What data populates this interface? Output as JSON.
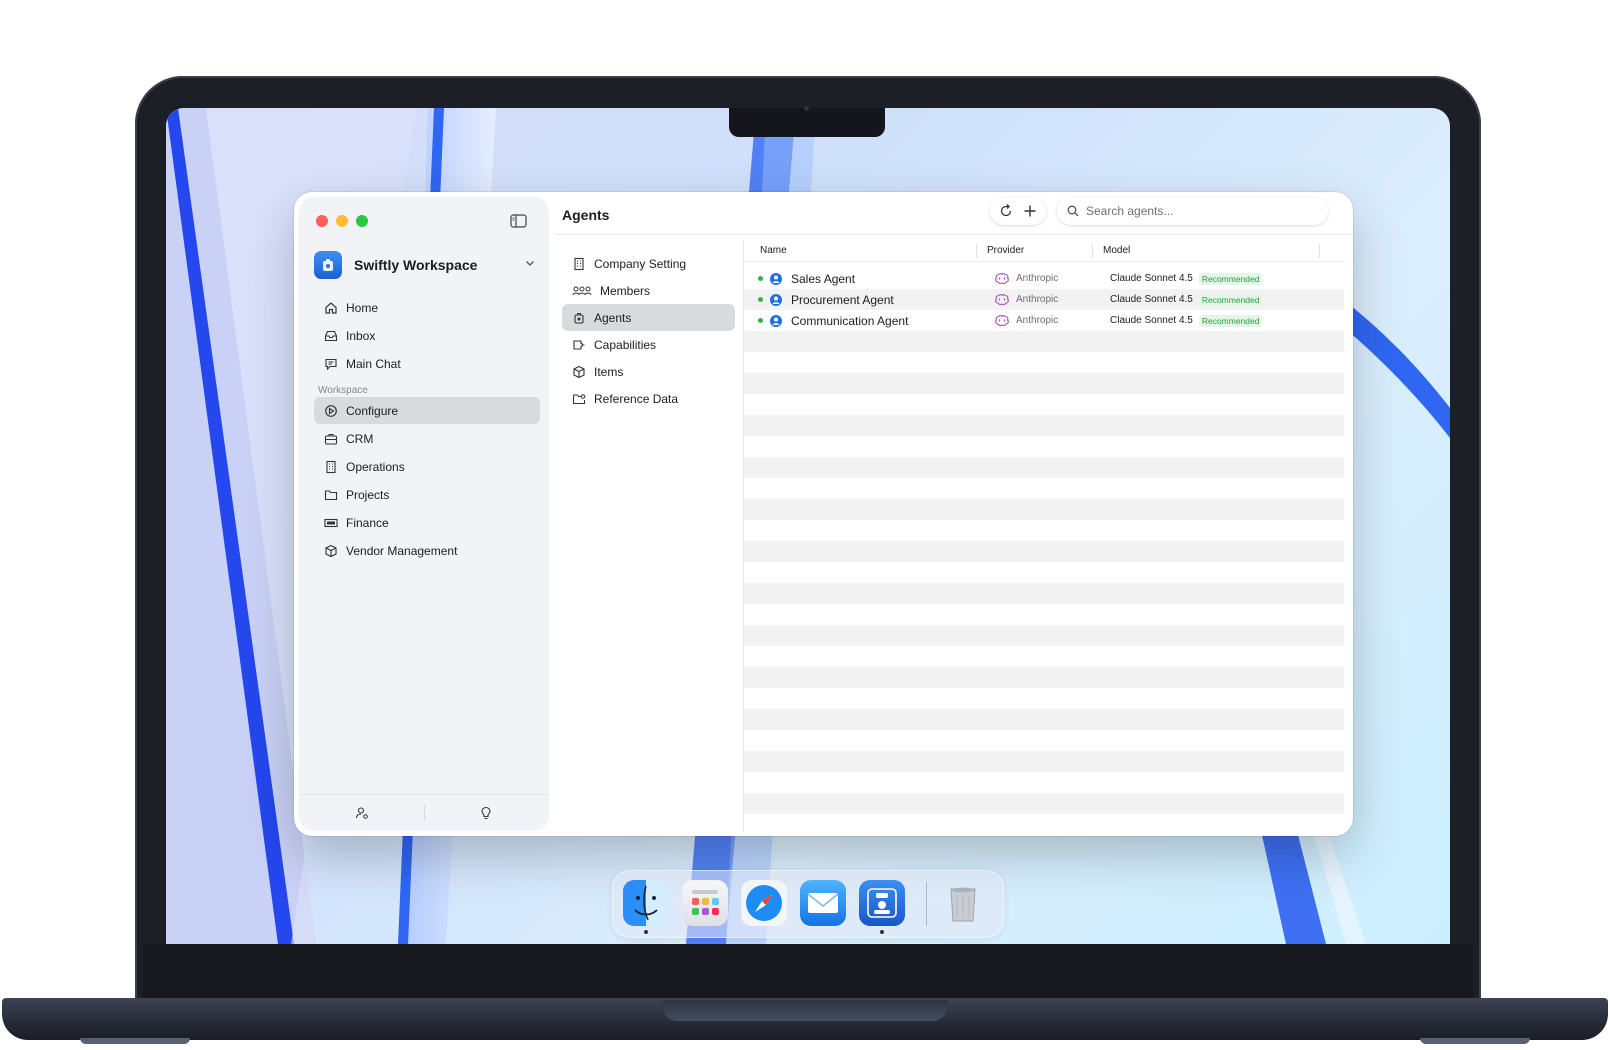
{
  "window": {
    "title": "Agents"
  },
  "workspace": {
    "name": "Swiftly Workspace"
  },
  "sidebar": {
    "items": [
      {
        "label": "Home",
        "icon": "home-icon"
      },
      {
        "label": "Inbox",
        "icon": "inbox-icon"
      },
      {
        "label": "Main Chat",
        "icon": "chat-icon"
      }
    ],
    "section_label": "Workspace",
    "workspace_items": [
      {
        "label": "Configure",
        "icon": "configure-icon",
        "active": true
      },
      {
        "label": "CRM",
        "icon": "briefcase-icon"
      },
      {
        "label": "Operations",
        "icon": "building-icon"
      },
      {
        "label": "Projects",
        "icon": "folder-icon"
      },
      {
        "label": "Finance",
        "icon": "money-icon"
      },
      {
        "label": "Vendor Management",
        "icon": "box-icon"
      }
    ]
  },
  "config_nav": [
    {
      "label": "Company Setting",
      "icon": "building-icon"
    },
    {
      "label": "Members",
      "icon": "members-icon"
    },
    {
      "label": "Agents",
      "icon": "agent-icon",
      "active": true
    },
    {
      "label": "Capabilities",
      "icon": "capabilities-icon"
    },
    {
      "label": "Items",
      "icon": "box-icon"
    },
    {
      "label": "Reference Data",
      "icon": "folder-data-icon"
    }
  ],
  "search": {
    "placeholder": "Search agents..."
  },
  "table": {
    "columns": [
      "Name",
      "Provider",
      "Model"
    ],
    "rows": [
      {
        "name": "Sales Agent",
        "provider": "Anthropic",
        "model": "Claude Sonnet 4.5",
        "badge": "Recommended",
        "status": "active"
      },
      {
        "name": "Procurement Agent",
        "provider": "Anthropic",
        "model": "Claude Sonnet 4.5",
        "badge": "Recommended",
        "status": "active"
      },
      {
        "name": "Communication Agent",
        "provider": "Anthropic",
        "model": "Claude Sonnet 4.5",
        "badge": "Recommended",
        "status": "active"
      }
    ]
  },
  "dock": {
    "apps": [
      "finder",
      "launchpad",
      "safari",
      "mail",
      "swiftly",
      "trash"
    ]
  },
  "colors": {
    "accent": "#1f6fe5",
    "status_green": "#30b34a",
    "badge_green": "#2a9d45",
    "provider_icon": "#b44fd0"
  }
}
